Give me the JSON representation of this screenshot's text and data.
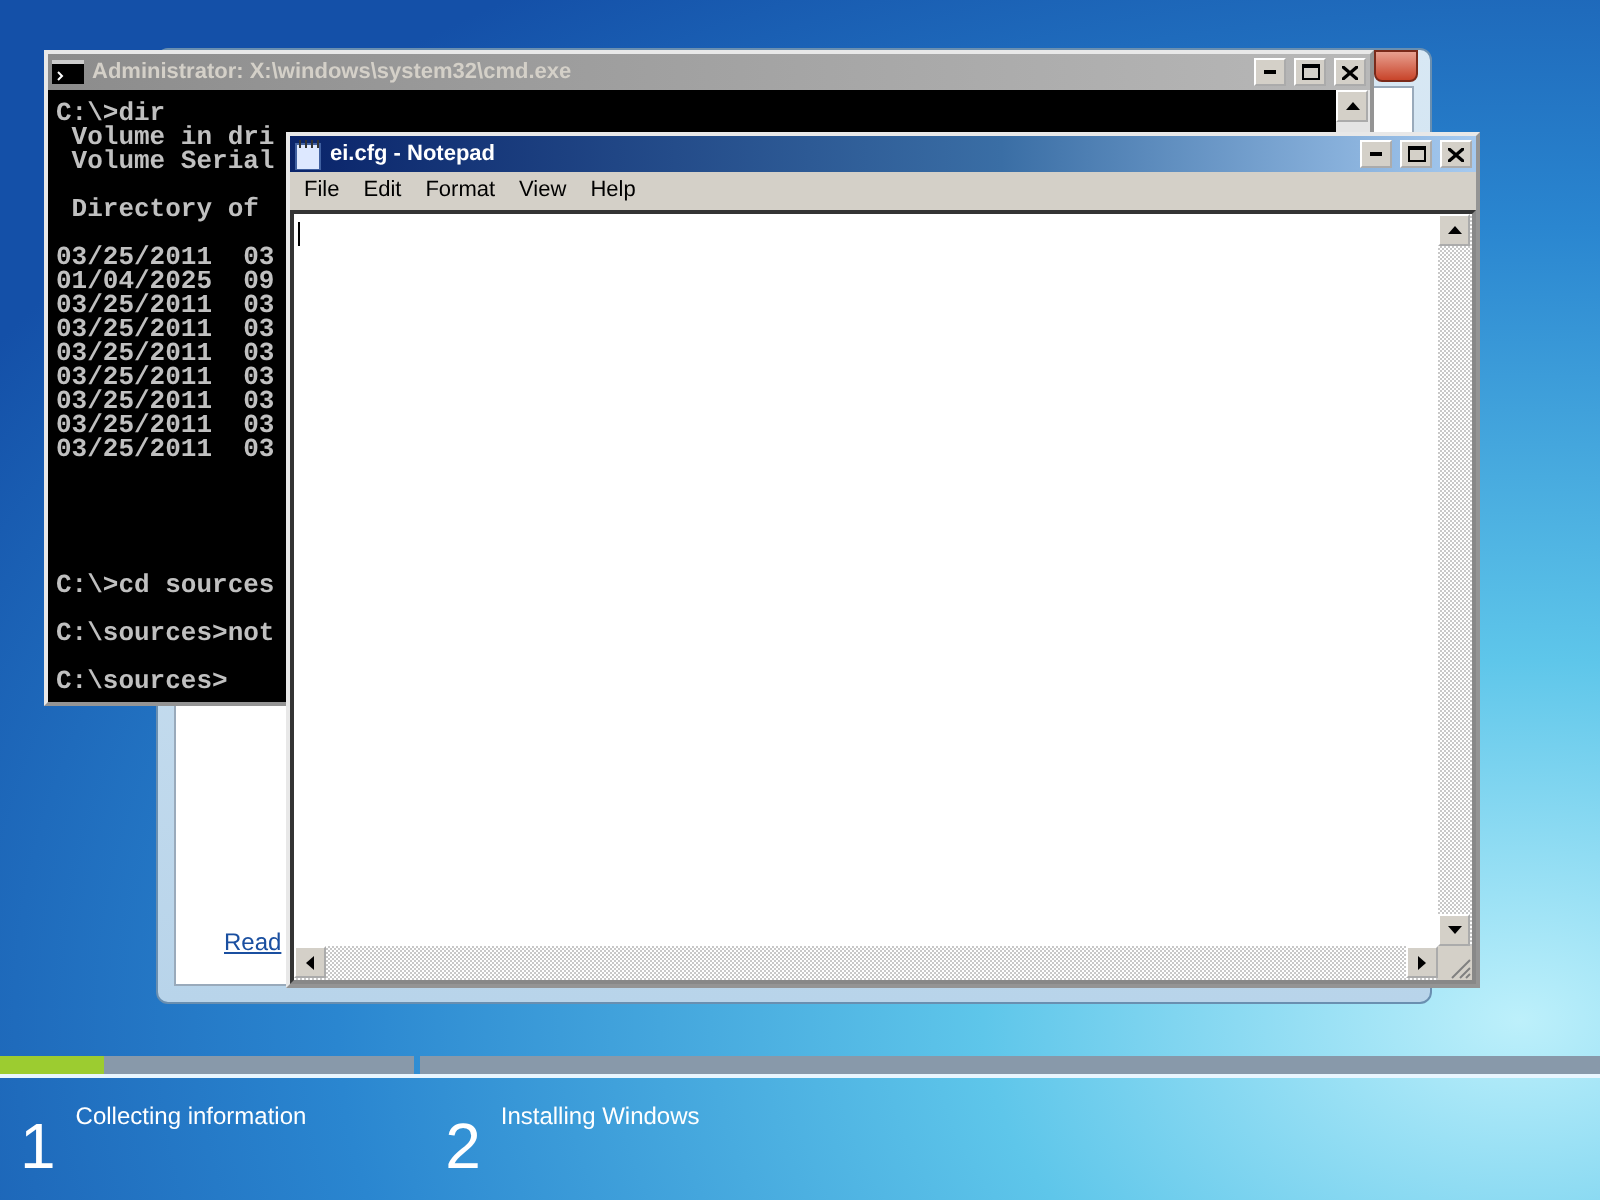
{
  "setup_window": {
    "link": "Read"
  },
  "console_window": {
    "title": "Administrator: X:\\windows\\system32\\cmd.exe",
    "active": false,
    "output": [
      [
        "C:\\>dir",
        " Volume in dri",
        " Volume Serial"
      ],
      [
        " Directory of"
      ],
      [
        "03/25/2011  03",
        "01/04/2025  09",
        "03/25/2011  03",
        "03/25/2011  03",
        "03/25/2011  03",
        "03/25/2011  03",
        "03/25/2011  03",
        "03/25/2011  03",
        "03/25/2011  03"
      ]
    ],
    "prompt": [
      [
        "C:\\>cd sources"
      ],
      [
        "C:\\sources>not"
      ],
      [
        "C:\\sources>"
      ]
    ]
  },
  "notepad": {
    "title": "ei.cfg - Notepad",
    "active": true,
    "menu": [
      "File",
      "Edit",
      "Format",
      "View",
      "Help"
    ]
  },
  "progress": {
    "steps": [
      {
        "number": "1",
        "label": "Collecting information",
        "level": 0.25
      },
      {
        "number": "2",
        "label": "Installing Windows"
      }
    ]
  }
}
